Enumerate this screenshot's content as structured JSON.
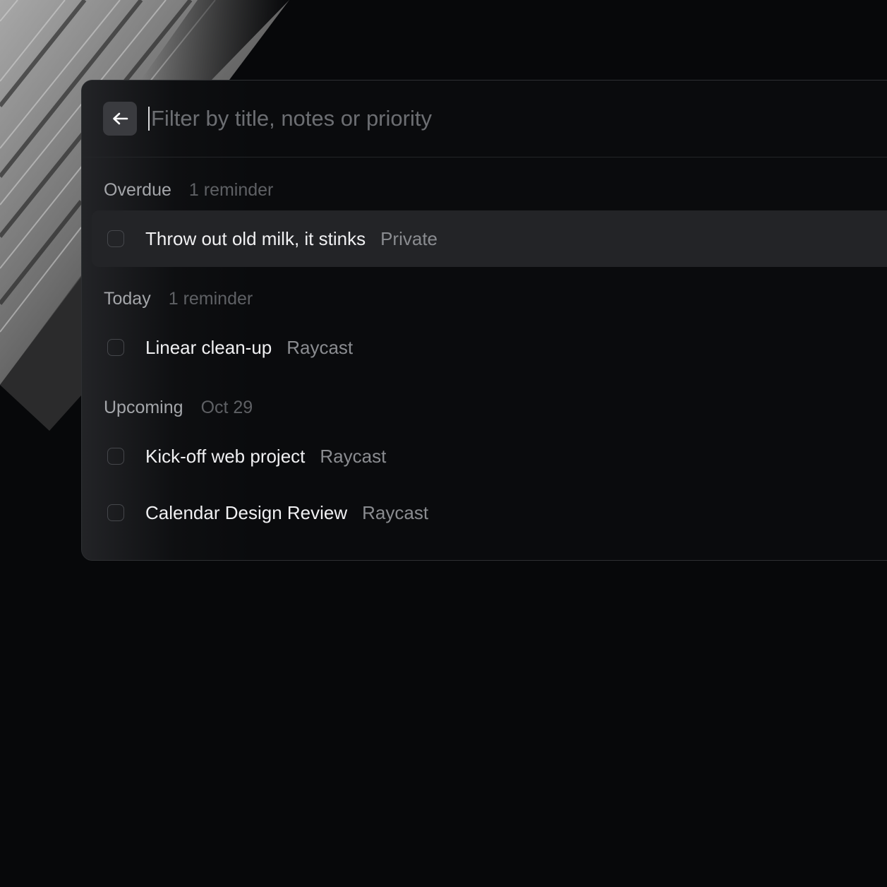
{
  "search": {
    "placeholder": "Filter by title, notes or priority",
    "value": ""
  },
  "back_button": {
    "icon": "arrow-left-icon"
  },
  "sections": [
    {
      "title": "Overdue",
      "meta": "1 reminder",
      "items": [
        {
          "title": "Throw out old milk, it stinks",
          "tag": "Private",
          "selected": true,
          "checked": false
        }
      ]
    },
    {
      "title": "Today",
      "meta": "1 reminder",
      "items": [
        {
          "title": "Linear clean-up",
          "tag": "Raycast",
          "selected": false,
          "checked": false
        }
      ]
    },
    {
      "title": "Upcoming",
      "meta": "Oct 29",
      "items": [
        {
          "title": "Kick-off web project",
          "tag": "Raycast",
          "selected": false,
          "checked": false
        },
        {
          "title": "Calendar Design Review",
          "tag": "Raycast",
          "selected": false,
          "checked": false
        }
      ]
    }
  ],
  "colors": {
    "background": "#07080a",
    "panel": "#0a0b0d",
    "selected_row": "#232427",
    "primary_text": "#f0f0f2",
    "secondary_text": "#8a8c90",
    "section_title": "#a4a6aa",
    "section_meta": "#5e6064"
  }
}
